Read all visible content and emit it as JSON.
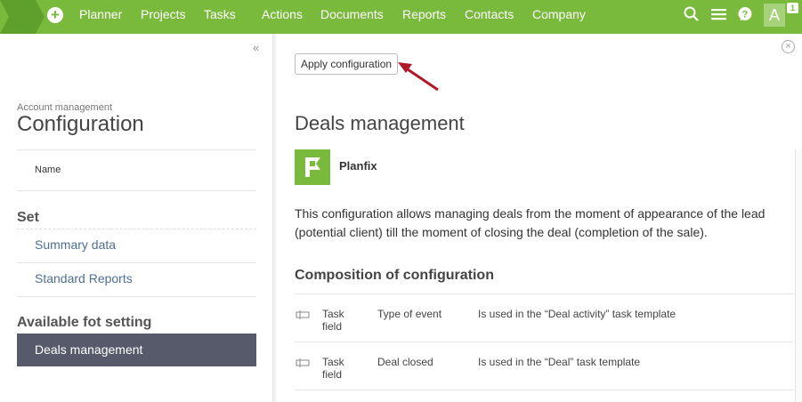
{
  "nav": {
    "items": [
      "Planner",
      "Projects",
      "Tasks",
      "Actions",
      "Documents",
      "Reports",
      "Contacts",
      "Company"
    ],
    "avatar_letter": "A",
    "notification_count": "1",
    "icons": [
      "plus-icon",
      "search-icon",
      "menu-icon",
      "help-icon"
    ]
  },
  "sidebar": {
    "breadcrumb": "Account management",
    "title": "Configuration",
    "name_label": "Name",
    "set_heading": "Set",
    "links": [
      "Summary data",
      "Standard Reports"
    ],
    "available_heading": "Available fot setting",
    "active_item": "Deals management"
  },
  "main": {
    "apply_button": "Apply configuration",
    "title": "Deals management",
    "brand_name": "Planfix",
    "description": "This configuration allows managing deals from the moment of appearance of the lead (potential client) till the moment of closing the deal (completion of the sale).",
    "composition_title": "Composition of configuration",
    "rows": [
      {
        "type": "Task field",
        "name": "Type of event",
        "note": "Is used in the “Deal activity” task template"
      },
      {
        "type": "Task field",
        "name": "Deal closed",
        "note": "Is used in the “Deal” task template"
      }
    ]
  },
  "colors": {
    "accent": "#79b93b",
    "active_item_bg": "#565a6b",
    "link": "#4f6f93",
    "arrow": "#b0182a"
  }
}
